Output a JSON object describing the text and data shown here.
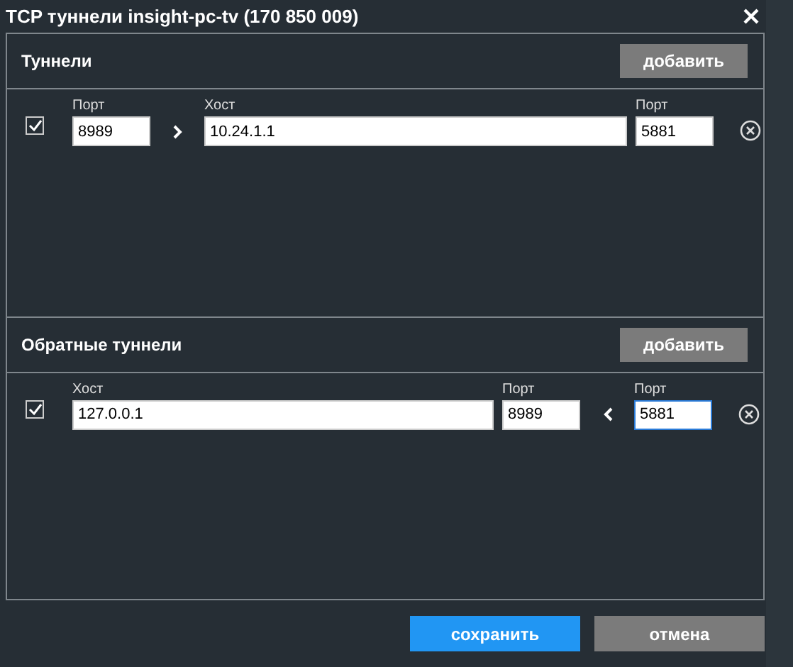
{
  "title": "TCP туннели insight-pc-tv (170 850 009)",
  "sections": [
    {
      "title": "Туннели",
      "add_button": "добавить",
      "rows": [
        {
          "checked": true,
          "cells": [
            {
              "kind": "field",
              "wide": false,
              "label": "Порт",
              "value": "8989",
              "focused": false
            },
            {
              "kind": "arrow_right"
            },
            {
              "kind": "field",
              "wide": true,
              "label": "Хост",
              "value": "10.24.1.1",
              "focused": false
            },
            {
              "kind": "field",
              "wide": false,
              "label": "Порт",
              "value": "5881",
              "focused": false
            }
          ]
        }
      ]
    },
    {
      "title": "Обратные туннели",
      "add_button": "добавить",
      "rows": [
        {
          "checked": true,
          "cells": [
            {
              "kind": "field",
              "wide": true,
              "label": "Хост",
              "value": "127.0.0.1",
              "focused": false
            },
            {
              "kind": "field",
              "wide": false,
              "label": "Порт",
              "value": "8989",
              "focused": false
            },
            {
              "kind": "arrow_left"
            },
            {
              "kind": "field",
              "wide": false,
              "label": "Порт",
              "value": "5881",
              "focused": true
            }
          ]
        }
      ]
    }
  ],
  "buttons": [
    {
      "label": "сохранить",
      "primary": true
    },
    {
      "label": "отмена",
      "primary": false
    }
  ]
}
